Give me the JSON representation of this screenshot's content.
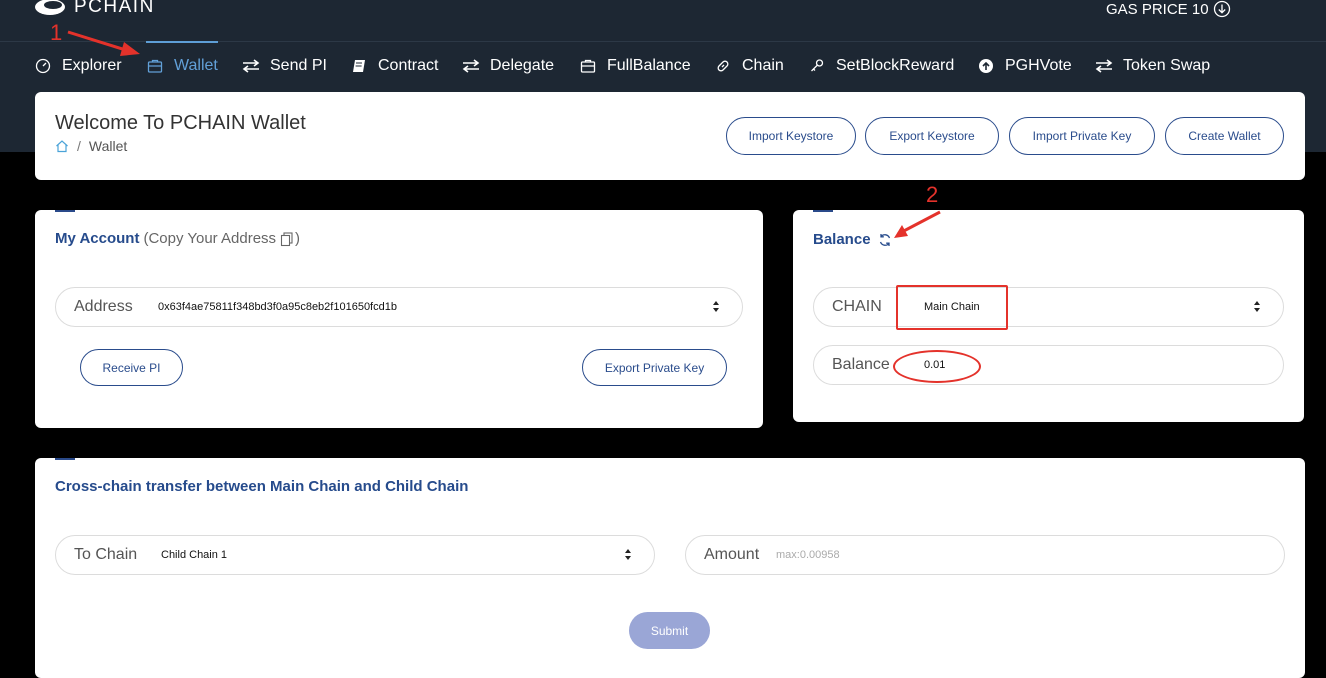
{
  "header": {
    "brand": "PCHAIN",
    "gas_price": "GAS PRICE 10"
  },
  "nav": {
    "items": [
      {
        "label": "Explorer",
        "icon": "speedometer-icon"
      },
      {
        "label": "Wallet",
        "icon": "wallet-icon",
        "active": true
      },
      {
        "label": "Send PI",
        "icon": "swap-arrows-icon"
      },
      {
        "label": "Contract",
        "icon": "book-icon"
      },
      {
        "label": "Delegate",
        "icon": "swap-arrows-icon"
      },
      {
        "label": "FullBalance",
        "icon": "briefcase-icon"
      },
      {
        "label": "Chain",
        "icon": "link-icon"
      },
      {
        "label": "SetBlockReward",
        "icon": "key-icon"
      },
      {
        "label": "PGHVote",
        "icon": "arrow-circle-up-icon"
      },
      {
        "label": "Token Swap",
        "icon": "swap-arrows-icon"
      }
    ]
  },
  "welcome": {
    "title": "Welcome To PCHAIN Wallet",
    "breadcrumb": "Wallet",
    "buttons": [
      "Import Keystore",
      "Export Keystore",
      "Import Private Key",
      "Create Wallet"
    ]
  },
  "account": {
    "title": "My Account",
    "copy_hint": "(Copy Your Address",
    "copy_hint_end": ")",
    "address_label": "Address",
    "address_value": "0x63f4ae75811f348bd3f0a95c8eb2f101650fcd1b",
    "receive_button": "Receive PI",
    "export_key_button": "Export Private Key"
  },
  "balance": {
    "title": "Balance",
    "chain_label": "CHAIN",
    "chain_value": "Main Chain",
    "balance_label": "Balance",
    "balance_value": "0.01"
  },
  "crosschain": {
    "title": "Cross-chain transfer between Main Chain and Child Chain",
    "to_chain_label": "To Chain",
    "to_chain_value": "Child Chain 1",
    "amount_label": "Amount",
    "amount_placeholder": "max:0.00958",
    "submit": "Submit"
  },
  "annotations": {
    "step1": "1",
    "step2": "2",
    "color": "#e4322b"
  }
}
